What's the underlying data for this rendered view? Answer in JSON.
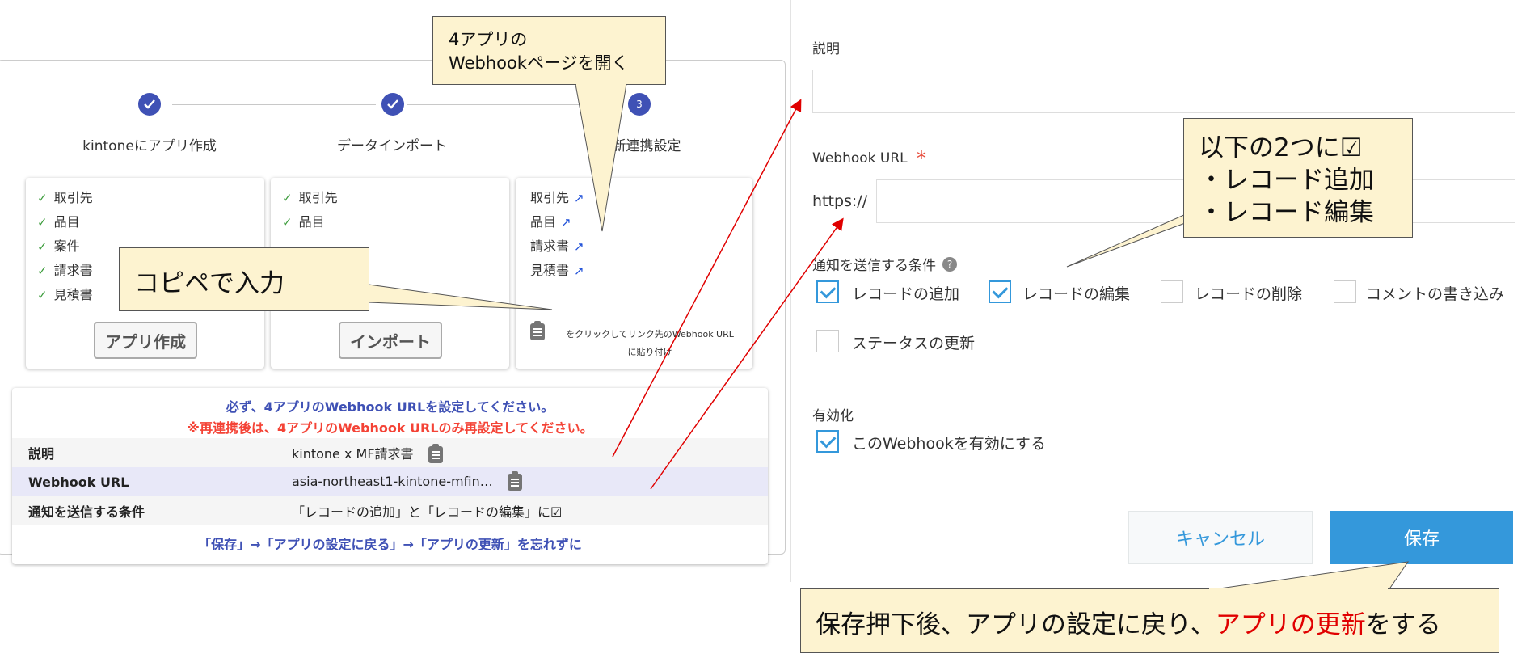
{
  "stepper": {
    "steps": [
      {
        "label": "kintoneにアプリ作成",
        "state": "done"
      },
      {
        "label": "データインポート",
        "state": "done"
      },
      {
        "label": "新連携設定",
        "state": "current",
        "number": "3"
      }
    ]
  },
  "cards": {
    "create": {
      "items": [
        "取引先",
        "品目",
        "案件",
        "請求書",
        "見積書"
      ],
      "button": "アプリ作成"
    },
    "import": {
      "items": [
        "取引先",
        "品目"
      ],
      "button": "インポート"
    },
    "links": {
      "items": [
        "取引先",
        "品目",
        "請求書",
        "見積書"
      ],
      "note_line1": "をクリックしてリンク先のWebhook URL",
      "note_line2": "に貼り付け"
    }
  },
  "info": {
    "line1": "必ず、4アプリのWebhook URLを設定してください。",
    "line2": "※再連携後は、4アプリのWebhook URLのみ再設定してください。",
    "rows": [
      {
        "label": "説明",
        "value": "kintone x MF請求書"
      },
      {
        "label": "Webhook URL",
        "value": "asia-northeast1-kintone-mfin…"
      },
      {
        "label": "通知を送信する条件",
        "value": "「レコードの追加」と「レコードの編集」に☑"
      }
    ],
    "footer": "「保存」→「アプリの設定に戻る」→「アプリの更新」を忘れずに"
  },
  "form": {
    "description_label": "説明",
    "webhook_label": "Webhook URL",
    "required_mark": "*",
    "url_prefix": "https://",
    "conditions_label": "通知を送信する条件",
    "help_icon": "?",
    "conditions": [
      {
        "label": "レコードの追加",
        "checked": true
      },
      {
        "label": "レコードの編集",
        "checked": true
      },
      {
        "label": "レコードの削除",
        "checked": false
      },
      {
        "label": "コメントの書き込み",
        "checked": false
      },
      {
        "label": "ステータスの更新",
        "checked": false
      }
    ],
    "enable_label": "有効化",
    "enable_checkbox": "このWebhookを有効にする",
    "cancel_button": "キャンセル",
    "save_button": "保存"
  },
  "callouts": {
    "open_webhook_line1": "4アプリの",
    "open_webhook_line2": "Webhookページを開く",
    "copy_paste": "コピペで入力",
    "check_line1": "以下の2つに☑",
    "check_line2": "・レコード追加",
    "check_line3": "・レコード編集",
    "after_save_part1": "保存押下後、アプリの設定に戻り、",
    "after_save_highlight": "アプリの更新",
    "after_save_part2": "をする"
  },
  "colors": {
    "primary": "#3f51b5",
    "warning": "#f44336",
    "save": "#3498db",
    "callout": "#fdf3d0",
    "arrow": "#e00000"
  }
}
